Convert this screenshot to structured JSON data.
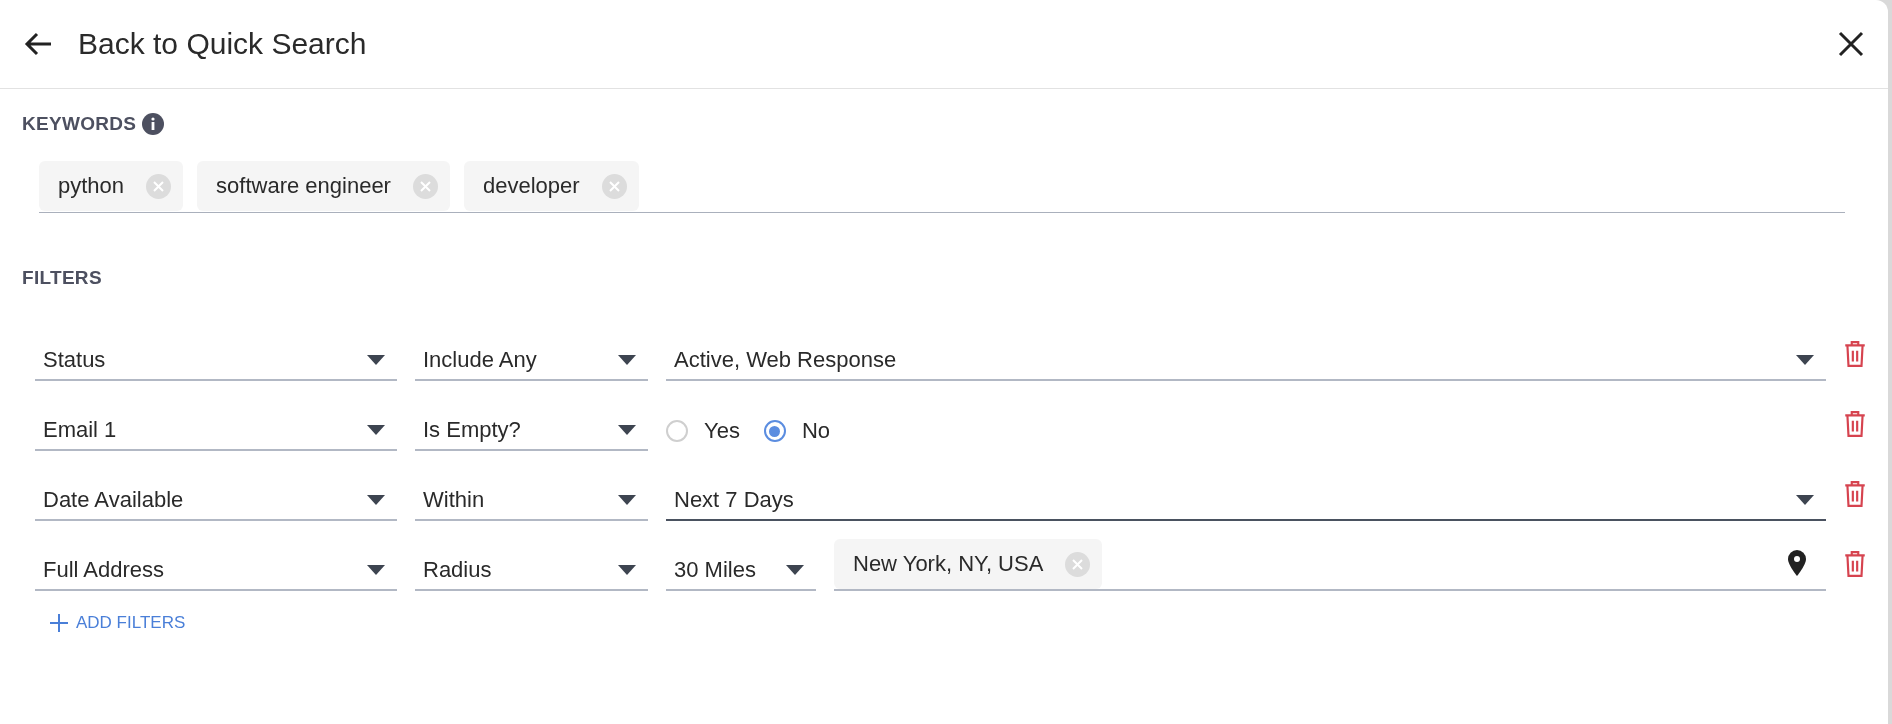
{
  "header": {
    "back_label": "Back to Quick Search"
  },
  "keywords": {
    "title": "KEYWORDS",
    "chips": [
      "python",
      "software engineer",
      "developer"
    ]
  },
  "filters": {
    "title": "FILTERS",
    "rows": [
      {
        "kind": "select",
        "field": "Status",
        "operator": "Include Any",
        "value": "Active, Web Response",
        "focused": false
      },
      {
        "kind": "radio",
        "field": "Email 1",
        "operator": "Is Empty?",
        "options": [
          {
            "label": "Yes",
            "selected": false
          },
          {
            "label": "No",
            "selected": true
          }
        ]
      },
      {
        "kind": "select",
        "field": "Date Available",
        "operator": "Within",
        "value": "Next 7 Days",
        "focused": true
      },
      {
        "kind": "location",
        "field": "Full Address",
        "operator": "Radius",
        "radius": "30 Miles",
        "locations": [
          "New York, NY, USA"
        ]
      }
    ],
    "add_label": "ADD FILTERS"
  }
}
